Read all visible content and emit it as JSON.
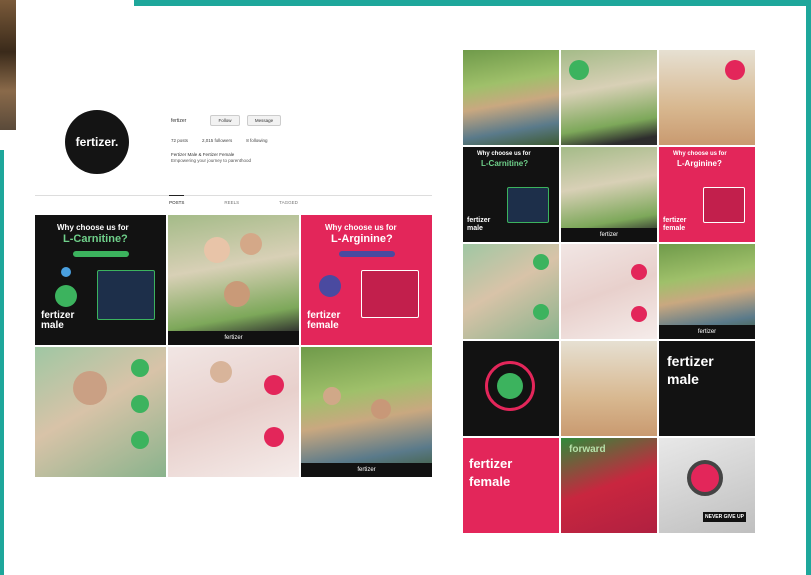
{
  "profile": {
    "avatar_text": "fertizer.",
    "name": "fertizer",
    "follow_label": "Follow",
    "message_label": "Message",
    "stats": [
      "72 posts",
      "2,015 followers",
      "8 following"
    ],
    "bio_line1": "Fertizer Male & Fertizer Female",
    "bio_line2": "Empowering your journey to parenthood",
    "tabs": [
      "POSTS",
      "REELS",
      "TAGGED"
    ]
  },
  "posts": {
    "lcarnitine_q": "Why choose us for",
    "lcarnitine_title": "L-Carnitine?",
    "larginine_q": "Why choose us for",
    "larginine_title": "L-Arginine?",
    "male_brand": "fertizer",
    "male_word": "male",
    "female_brand": "fertizer",
    "female_word": "female",
    "banner": "fertizer",
    "male_big_brand": "fertizer",
    "male_big_word": "male",
    "female_big_brand": "fertizer",
    "female_big_word": "female",
    "flyer_text": "forward",
    "motive_text": "NEVER GIVE UP"
  },
  "colors": {
    "teal_frame": "#1ea79b",
    "brand_pink": "#e3265a",
    "brand_green": "#6fd08a",
    "dark": "#121212"
  }
}
